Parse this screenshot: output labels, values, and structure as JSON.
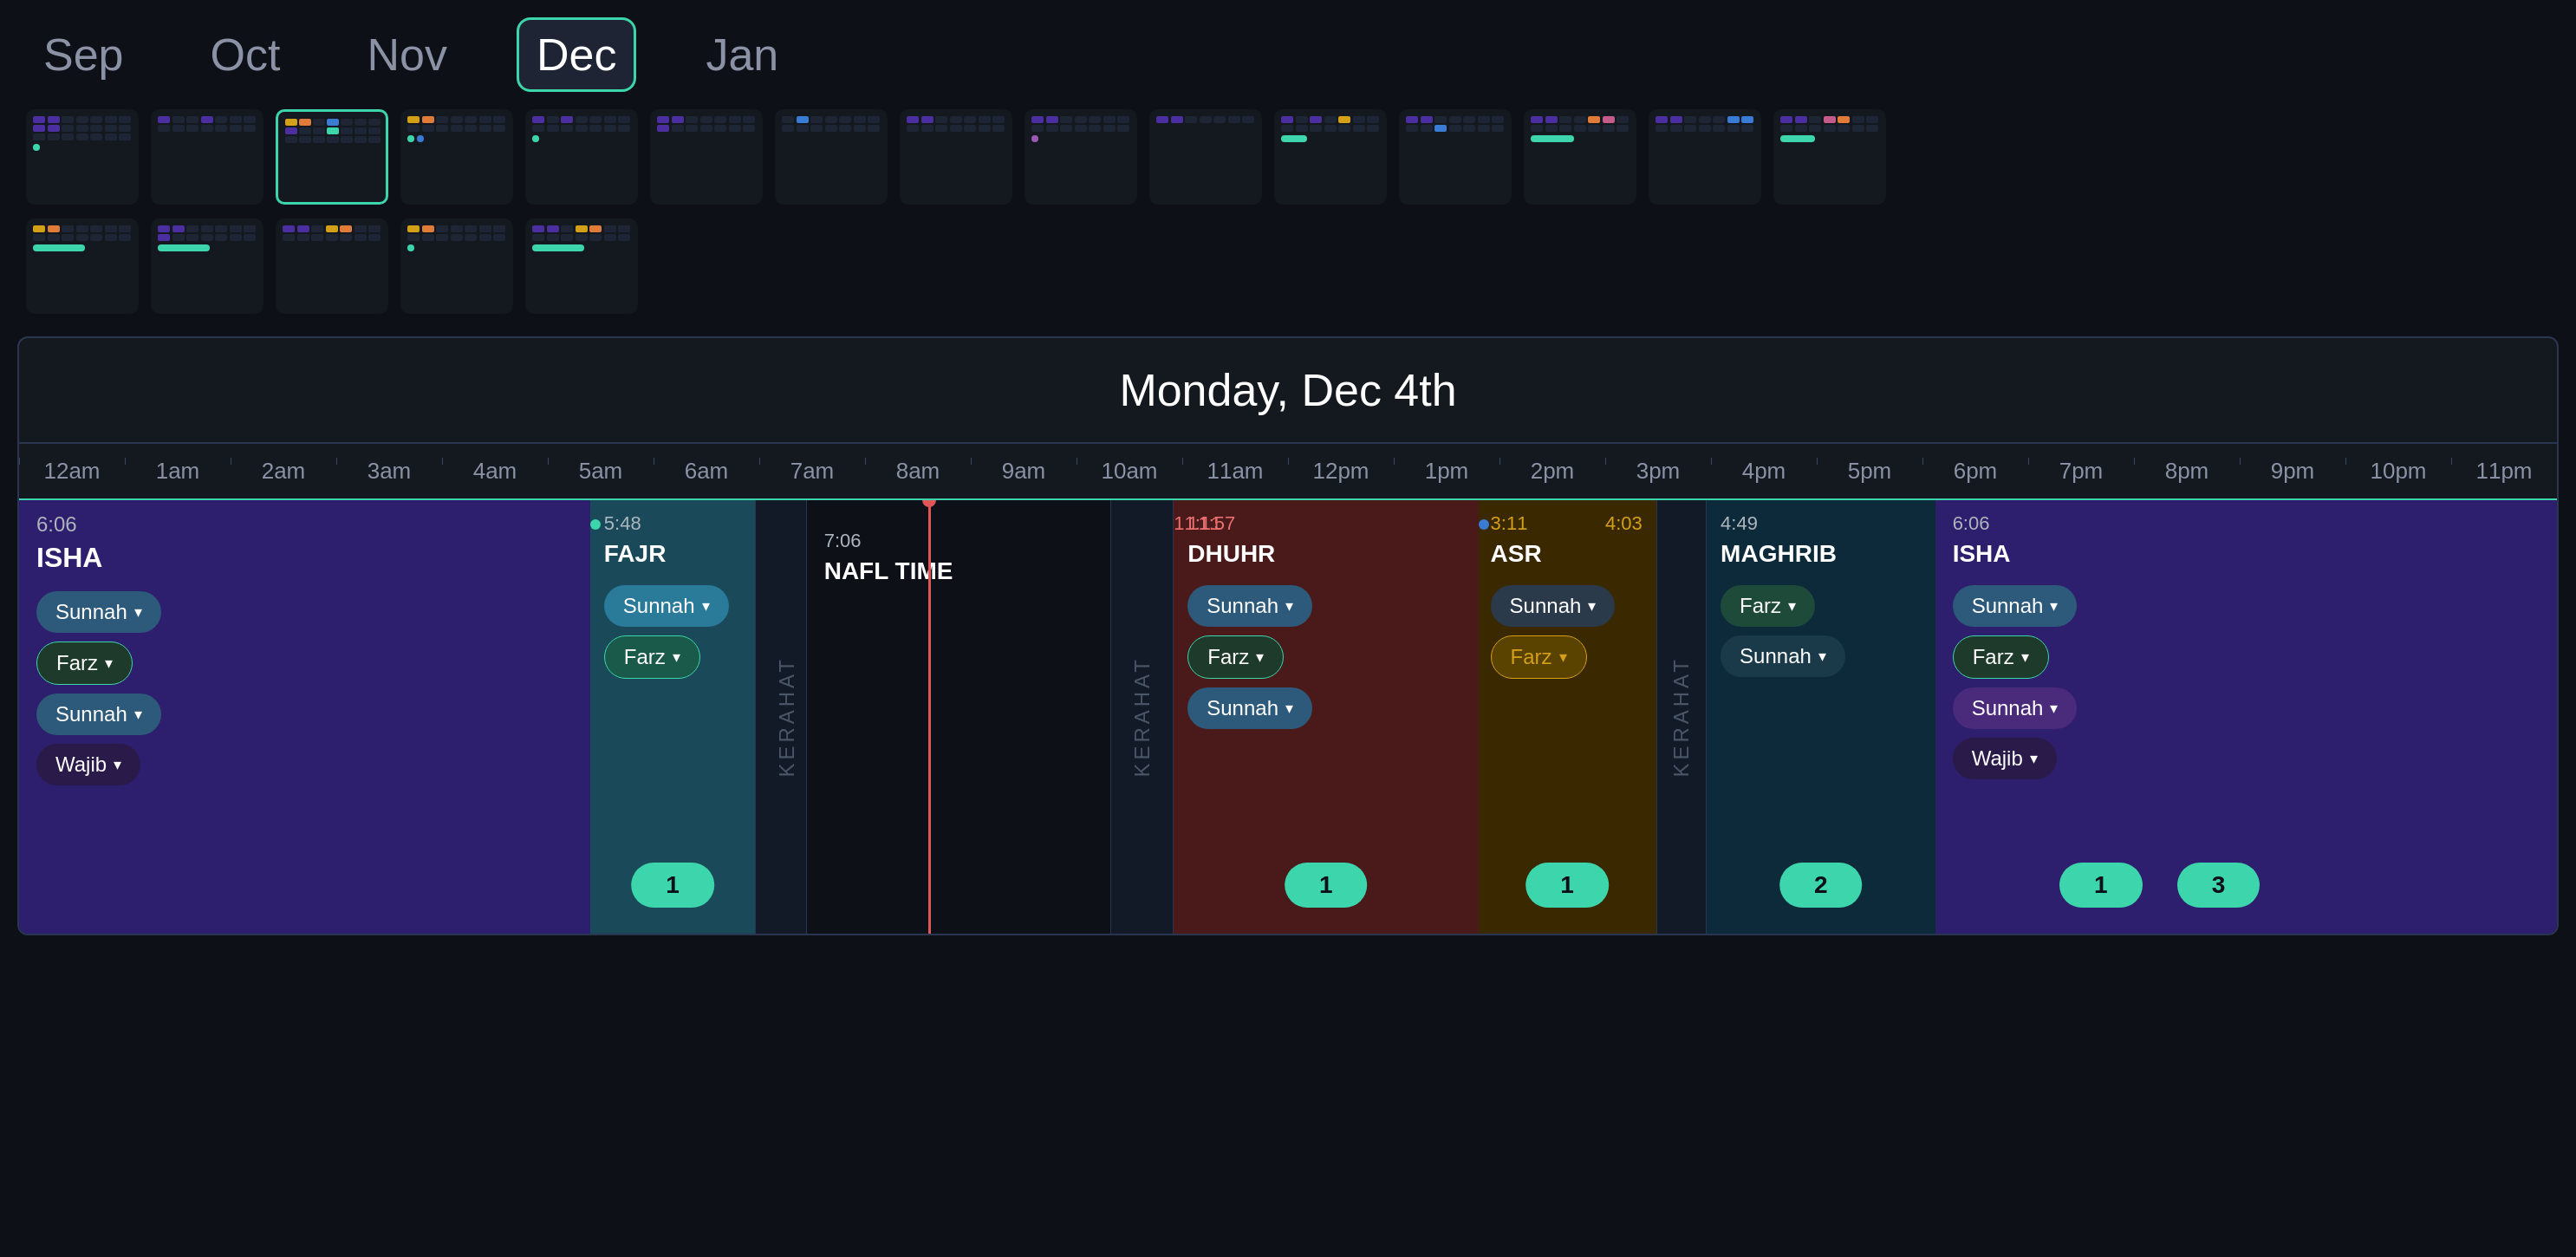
{
  "months": {
    "labels": [
      "Sep",
      "Oct",
      "Nov",
      "Dec",
      "Jan"
    ],
    "active": "Dec"
  },
  "timeline": {
    "title": "Monday, Dec 4th"
  },
  "time_slots": [
    "12am",
    "1am",
    "2am",
    "3am",
    "4am",
    "5am",
    "6am",
    "7am",
    "8am",
    "9am",
    "10am",
    "11am",
    "12pm",
    "1pm",
    "2pm",
    "3pm",
    "4pm",
    "5pm",
    "6pm",
    "7pm",
    "8pm",
    "9pm",
    "10pm",
    "11pm"
  ],
  "prayers": [
    {
      "name": "ISHA",
      "time": "6:06",
      "side": "left",
      "color": "purple",
      "pills": [
        {
          "label": "Sunnah",
          "style": "sunnah"
        },
        {
          "label": "Farz",
          "style": "farz"
        },
        {
          "label": "Sunnah",
          "style": "sunnah"
        },
        {
          "label": "Wajib",
          "style": "wajib"
        }
      ]
    },
    {
      "name": "FAJR",
      "time": "5:48",
      "color": "teal",
      "pills": [
        {
          "label": "Sunnah",
          "style": "sunnah-teal"
        },
        {
          "label": "Farz",
          "style": "farz-teal"
        }
      ],
      "badge": "1"
    },
    {
      "name": "NAFL TIME",
      "time": "",
      "color": "dark"
    },
    {
      "name": "DHUHR",
      "time": "11:57",
      "color": "red",
      "pills": [
        {
          "label": "Sunnah",
          "style": "sunnah"
        },
        {
          "label": "Farz",
          "style": "farz"
        },
        {
          "label": "Sunnah",
          "style": "sunnah"
        }
      ],
      "badge": "1"
    },
    {
      "name": "ASR",
      "time": "3:11",
      "color": "brown",
      "pills": [
        {
          "label": "Sunnah",
          "style": "sunnah-gray"
        },
        {
          "label": "Farz",
          "style": "farz-yellow"
        }
      ],
      "badge": "1"
    },
    {
      "name": "MAGHRIB",
      "time": "4:49",
      "color": "dark-teal",
      "pills": [
        {
          "label": "Farz",
          "style": "farz"
        },
        {
          "label": "Sunnah",
          "style": "sunnah"
        }
      ],
      "badge": "2"
    },
    {
      "name": "ISHA",
      "time": "6:06",
      "side": "right",
      "color": "purple",
      "pills": [
        {
          "label": "Sunnah",
          "style": "sunnah"
        },
        {
          "label": "Farz",
          "style": "farz"
        },
        {
          "label": "Sunnah",
          "style": "sunnah-purple"
        },
        {
          "label": "Wajib",
          "style": "wajib"
        }
      ],
      "badges": [
        "1",
        "3"
      ]
    }
  ],
  "current_time_position": "10am",
  "colors": {
    "purple": "#2d1f6e",
    "teal": "#1a4a5a",
    "dark": "#0d1117",
    "red": "#4a1a1a",
    "brown": "#3a2800",
    "dark_teal": "#0d2a3a",
    "green_accent": "#3dd6ac",
    "orange_accent": "#e07b39",
    "yellow_accent": "#d4a017"
  }
}
